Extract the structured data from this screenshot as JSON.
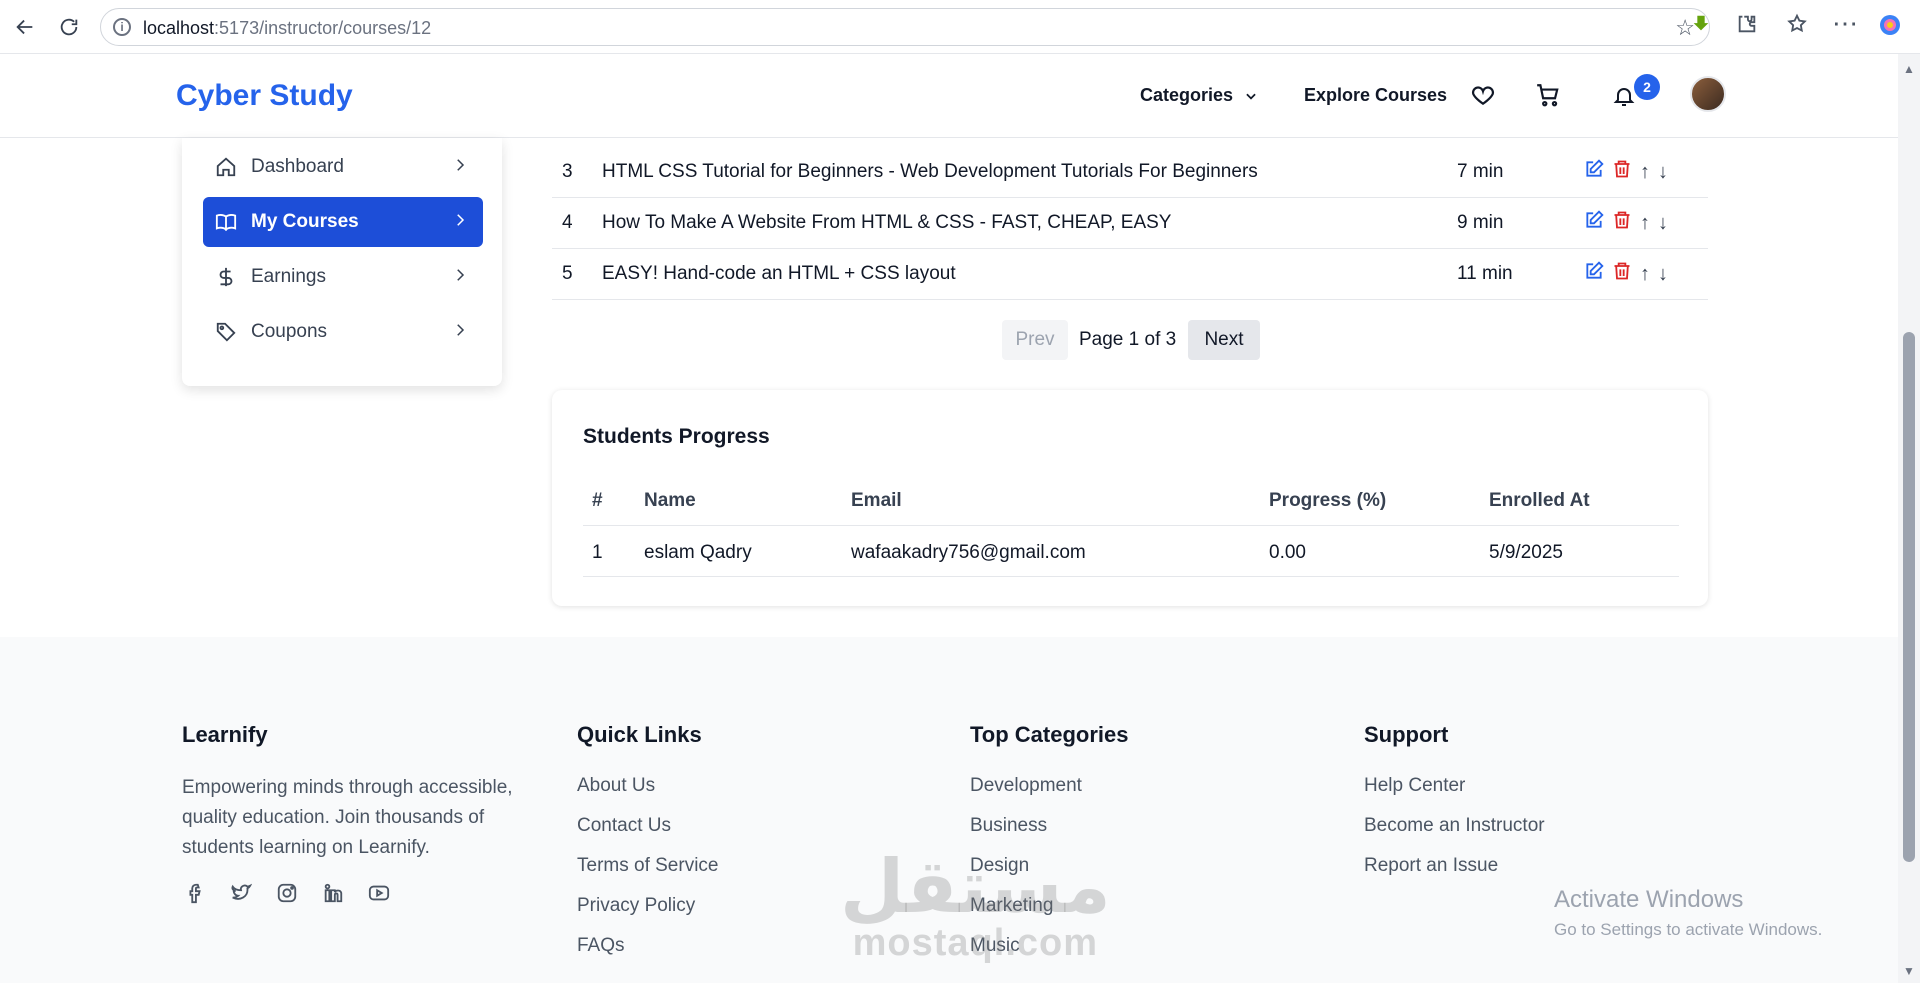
{
  "browser": {
    "url_host": "localhost",
    "url_rest": ":5173/instructor/courses/12"
  },
  "header": {
    "brand": "Cyber Study",
    "categories_label": "Categories",
    "explore_label": "Explore Courses",
    "notification_count": "2",
    "accent_color": "#2563eb"
  },
  "sidebar": {
    "items": [
      {
        "label": "Dashboard",
        "icon": "home-icon"
      },
      {
        "label": "My Courses",
        "icon": "book-icon",
        "active": true
      },
      {
        "label": "Earnings",
        "icon": "dollar-icon"
      },
      {
        "label": "Coupons",
        "icon": "tag-icon"
      }
    ]
  },
  "lessons": [
    {
      "num": "3",
      "title": "HTML CSS Tutorial for Beginners - Web Development Tutorials For Beginners",
      "duration": "7 min"
    },
    {
      "num": "4",
      "title": "How To Make A Website From HTML & CSS - FAST, CHEAP, EASY",
      "duration": "9 min"
    },
    {
      "num": "5",
      "title": "EASY! Hand-code an HTML + CSS layout",
      "duration": "11 min"
    }
  ],
  "lesson_actions": {
    "up": "↑",
    "down": "↓"
  },
  "pagination": {
    "prev_label": "Prev",
    "next_label": "Next",
    "page_text": "Page 1 of 3"
  },
  "students": {
    "title": "Students Progress",
    "columns": [
      "#",
      "Name",
      "Email",
      "Progress (%)",
      "Enrolled At"
    ],
    "rows": [
      [
        "1",
        "eslam Qadry",
        "wafaakadry756@gmail.com",
        "0.00",
        "5/9/2025"
      ]
    ]
  },
  "footer": {
    "about": {
      "title": "Learnify",
      "description": "Empowering minds through accessible, quality education. Join thousands of students learning on Learnify."
    },
    "quick_links": {
      "title": "Quick Links",
      "items": [
        "About Us",
        "Contact Us",
        "Terms of Service",
        "Privacy Policy",
        "FAQs"
      ]
    },
    "top_categories": {
      "title": "Top Categories",
      "items": [
        "Development",
        "Business",
        "Design",
        "Marketing",
        "Music"
      ]
    },
    "support": {
      "title": "Support",
      "items": [
        "Help Center",
        "Become an Instructor",
        "Report an Issue"
      ]
    },
    "socials": [
      "facebook-icon",
      "twitter-icon",
      "instagram-icon",
      "linkedin-icon",
      "youtube-icon"
    ]
  },
  "watermark": {
    "arabic": "مستقل",
    "latin": "mostaql.com"
  },
  "os_overlay": {
    "title": "Activate Windows",
    "subtitle": "Go to Settings to activate Windows."
  }
}
